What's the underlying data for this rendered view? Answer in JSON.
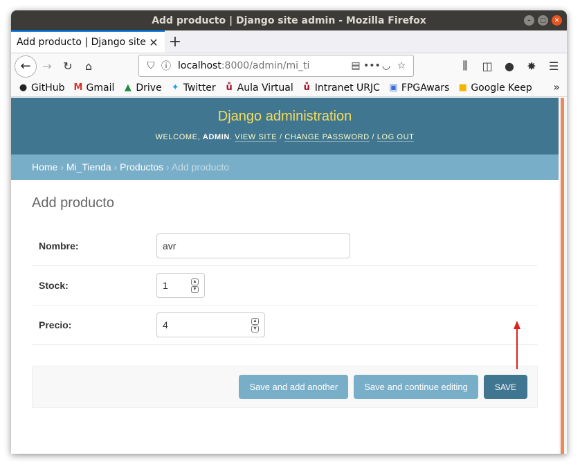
{
  "window": {
    "title": "Add producto | Django site admin - Mozilla Firefox"
  },
  "tab": {
    "title": "Add producto | Django site admin",
    "new_tab_symbol": "+"
  },
  "navbar": {
    "url_host": "localhost",
    "url_rest": ":8000/admin/mi_ti"
  },
  "bookmarks": [
    {
      "label": "GitHub",
      "icon": "github-icon"
    },
    {
      "label": "Gmail",
      "icon": "gmail-icon"
    },
    {
      "label": "Drive",
      "icon": "drive-icon"
    },
    {
      "label": "Twitter",
      "icon": "twitter-icon"
    },
    {
      "label": "Aula Virtual",
      "icon": "urjc-icon"
    },
    {
      "label": "Intranet URJC",
      "icon": "urjc-icon"
    },
    {
      "label": "FPGAwars",
      "icon": "fpgawars-icon"
    },
    {
      "label": "Google Keep",
      "icon": "keep-icon"
    }
  ],
  "header": {
    "brand": "Django administration",
    "welcome": "Welcome,",
    "username": "admin",
    "view_site": "View site",
    "change_password": "Change password",
    "log_out": "Log out"
  },
  "breadcrumbs": {
    "home": "Home",
    "app": "Mi_Tienda",
    "model": "Productos",
    "current": "Add producto"
  },
  "form": {
    "title": "Add producto",
    "fields": [
      {
        "label": "Nombre:",
        "value": "avr"
      },
      {
        "label": "Stock:",
        "value": "1"
      },
      {
        "label": "Precio:",
        "value": "4"
      }
    ]
  },
  "buttons": {
    "save_add_another": "Save and add another",
    "save_continue": "Save and continue editing",
    "save": "SAVE"
  },
  "colors": {
    "header_bg": "#417690",
    "brand": "#f5dd5d",
    "breadcrumbs_bg": "#79aec8",
    "button": "#79aec8",
    "default_button": "#417690",
    "annotation_arrow": "#e0201a"
  }
}
